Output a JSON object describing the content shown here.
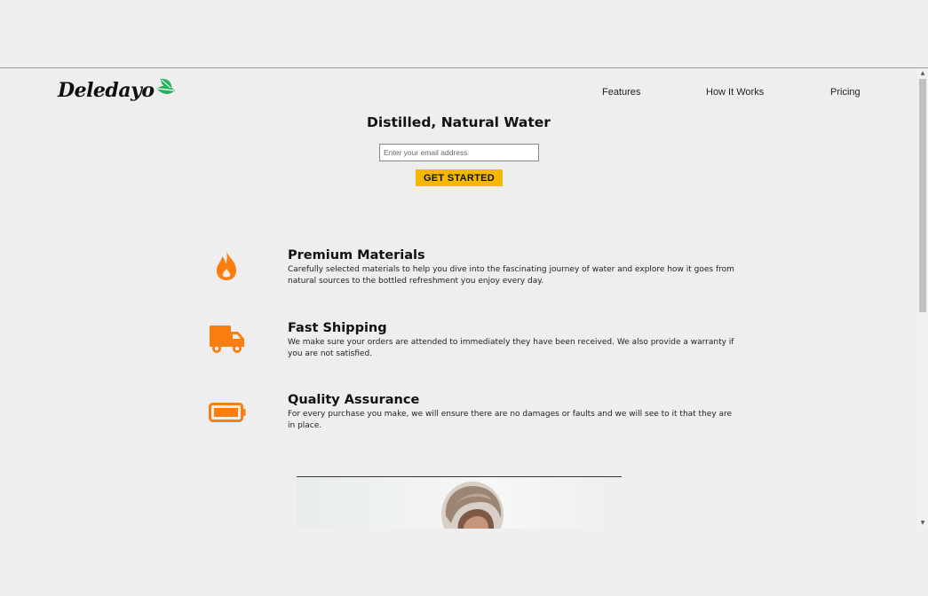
{
  "header": {
    "logo_text": "Deledayo",
    "nav": [
      {
        "label": "Features"
      },
      {
        "label": "How It Works"
      },
      {
        "label": "Pricing"
      }
    ]
  },
  "hero": {
    "title": "Distilled, Natural Water",
    "email_placeholder": "Enter your email address",
    "email_value": "",
    "cta_label": "GET STARTED"
  },
  "features": [
    {
      "icon": "fire-icon",
      "title": "Premium Materials",
      "description": "Carefully selected materials to help you dive into the fascinating journey of water and explore how it goes from natural sources to the bottled refreshment you enjoy every day."
    },
    {
      "icon": "truck-icon",
      "title": "Fast Shipping",
      "description": "We make sure your orders are attended to immediately they have been received. We also provide a warranty if you are not satisfied."
    },
    {
      "icon": "battery-icon",
      "title": "Quality Assurance",
      "description": "For every purchase you make, we will ensure there are no damages or faults and we will see to it that they are in place."
    }
  ],
  "colors": {
    "accent_orange": "#fa7d0f",
    "cta_yellow": "#f5b800",
    "logo_leaf_green": "#1fb35a",
    "background": "#eeeeee"
  }
}
